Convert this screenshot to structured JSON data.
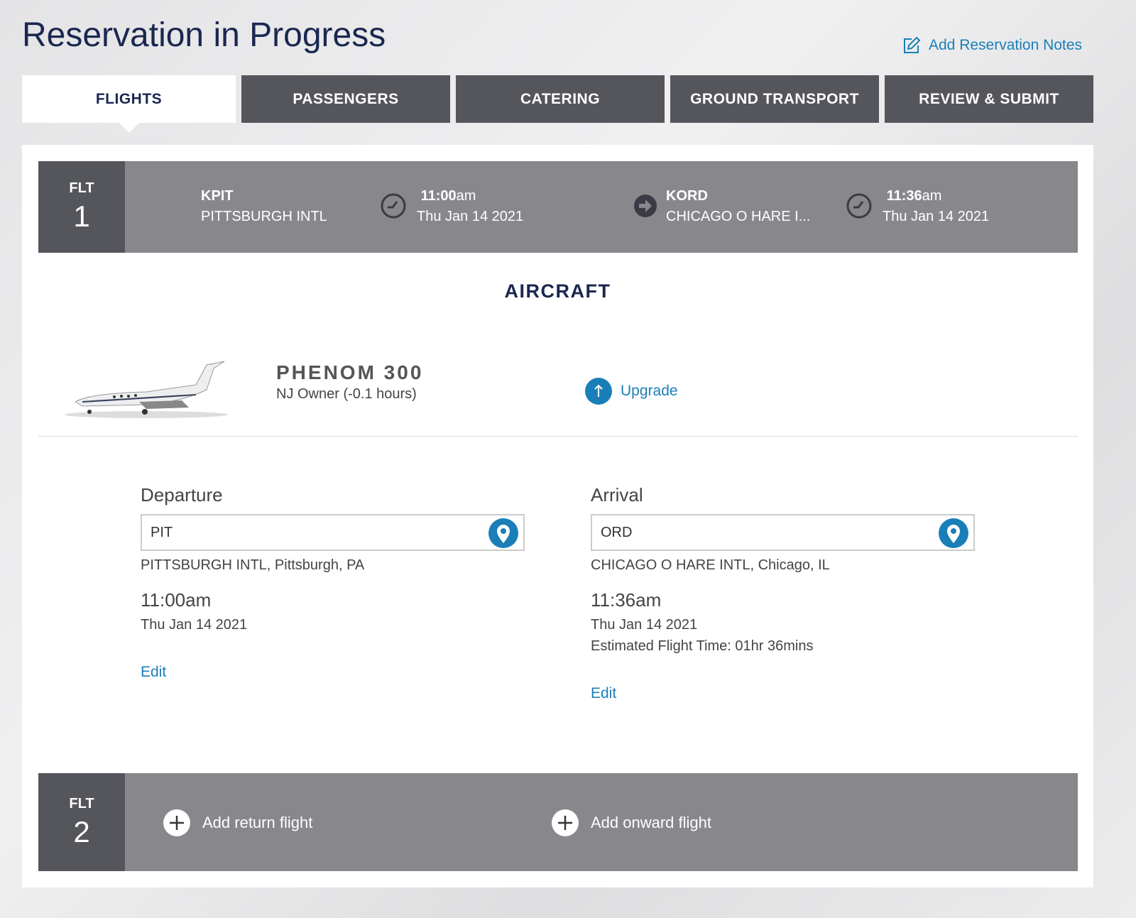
{
  "header": {
    "title": "Reservation in Progress",
    "notes_link": "Add Reservation Notes"
  },
  "tabs": [
    {
      "label": "FLIGHTS",
      "active": true
    },
    {
      "label": "PASSENGERS"
    },
    {
      "label": "CATERING"
    },
    {
      "label": "GROUND TRANSPORT"
    },
    {
      "label": "REVIEW & SUBMIT"
    }
  ],
  "flight1": {
    "flt_label": "FLT",
    "number": "1",
    "origin_code": "KPIT",
    "origin_name": "PITTSBURGH INTL",
    "dep_time_bold": "11:00",
    "dep_time_suffix": "am",
    "dep_date": "Thu Jan 14 2021",
    "dest_code": "KORD",
    "dest_name": "CHICAGO O HARE I...",
    "arr_time_bold": "11:36",
    "arr_time_suffix": "am",
    "arr_date": "Thu Jan 14 2021"
  },
  "aircraft": {
    "heading": "AIRCRAFT",
    "name": "PHENOM 300",
    "detail": "NJ Owner (-0.1 hours)",
    "upgrade": "Upgrade"
  },
  "departure": {
    "label": "Departure",
    "value": "PIT",
    "airport": "PITTSBURGH INTL, Pittsburgh, PA",
    "time": "11:00am",
    "date": "Thu Jan 14 2021",
    "edit": "Edit"
  },
  "arrival": {
    "label": "Arrival",
    "value": "ORD",
    "airport": "CHICAGO O HARE INTL, Chicago, IL",
    "time": "11:36am",
    "date": "Thu Jan 14 2021",
    "flight_time": "Estimated Flight Time: 01hr 36mins",
    "edit": "Edit"
  },
  "flight2": {
    "flt_label": "FLT",
    "number": "2",
    "add_return": "Add return flight",
    "add_onward": "Add onward flight"
  },
  "colors": {
    "navy": "#1a2750",
    "link": "#1a7fb8",
    "tab_dark": "#55565b",
    "bar": "#88878c"
  }
}
